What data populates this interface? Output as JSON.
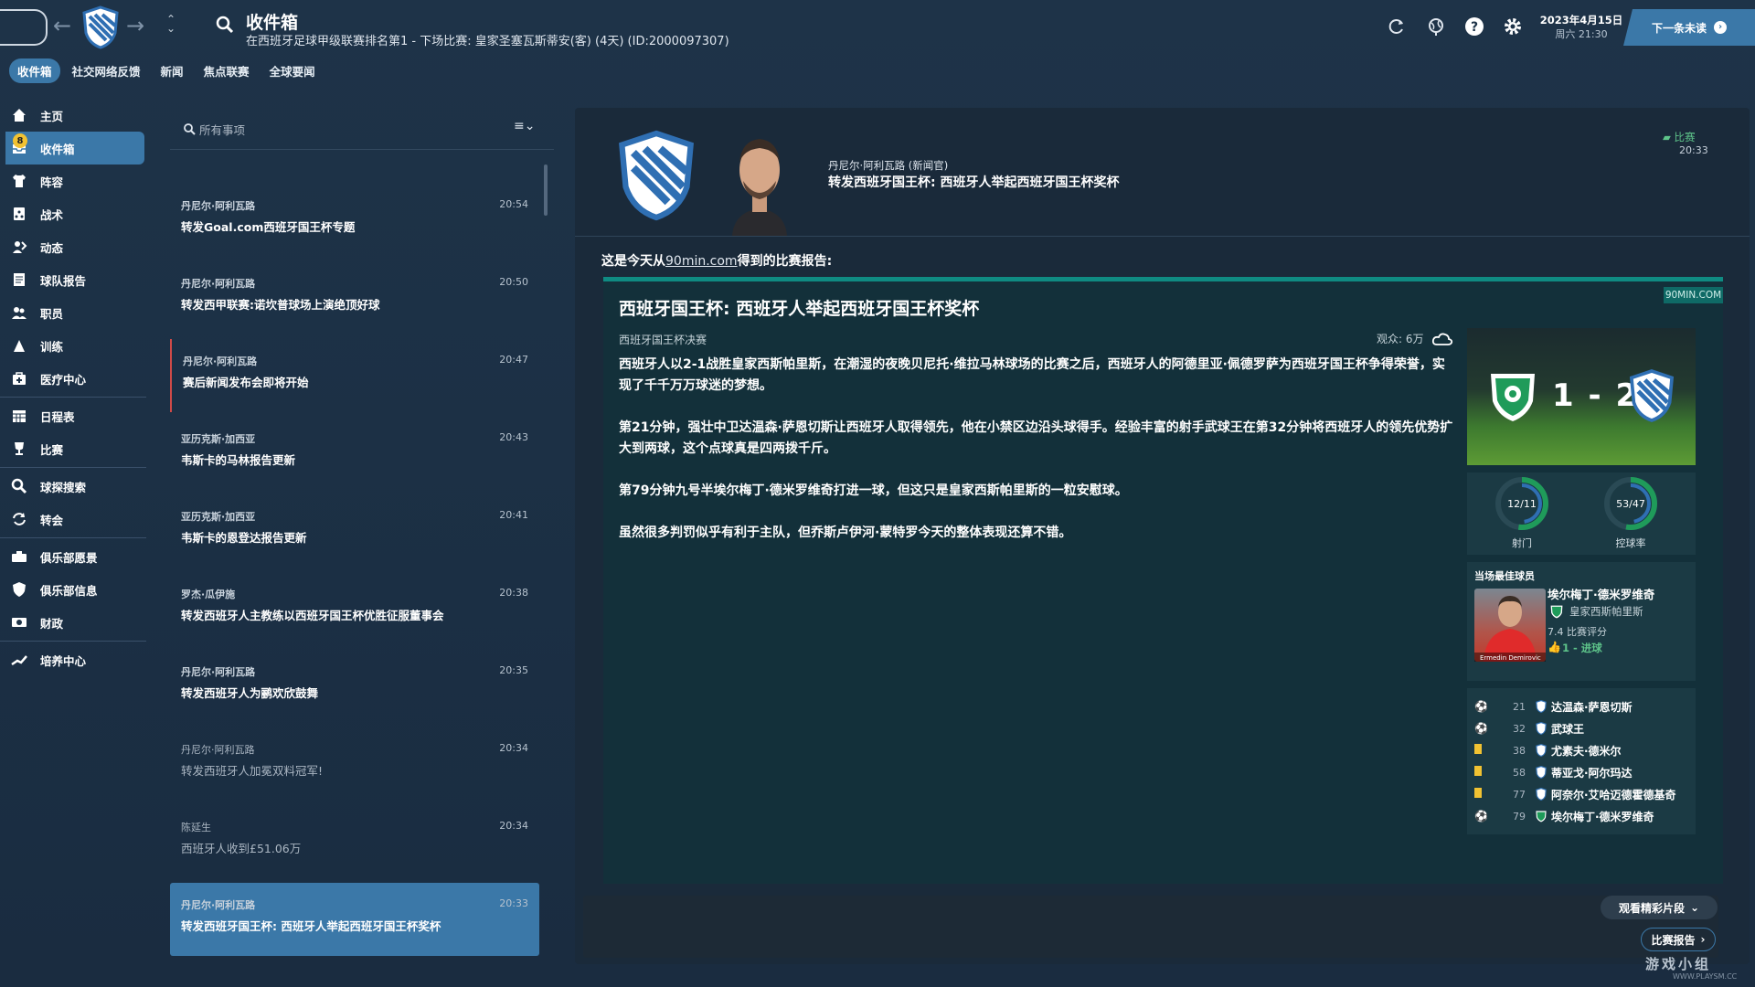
{
  "header": {
    "title": "收件箱",
    "subtitle": "在西班牙足球甲级联赛排名第1 - 下场比赛: 皇家圣塞瓦斯蒂安(客) (4天) (ID:2000097307)",
    "date": "2023年4月15日",
    "day_time": "周六 21:30",
    "next_button": "下一条未读"
  },
  "tabs": [
    {
      "label": "收件箱",
      "active": true
    },
    {
      "label": "社交网络反馈"
    },
    {
      "label": "新闻"
    },
    {
      "label": "焦点联赛"
    },
    {
      "label": "全球要闻"
    }
  ],
  "sidebar": {
    "badge": "8",
    "items": [
      {
        "label": "主页",
        "icon": "home-icon"
      },
      {
        "label": "收件箱",
        "icon": "inbox-icon"
      },
      {
        "label": "阵容",
        "icon": "shirt-icon"
      },
      {
        "label": "战术",
        "icon": "tactics-icon"
      },
      {
        "label": "动态",
        "icon": "dynamics-icon"
      },
      {
        "label": "球队报告",
        "icon": "report-icon"
      },
      {
        "label": "职员",
        "icon": "staff-icon"
      },
      {
        "label": "训练",
        "icon": "training-icon"
      },
      {
        "label": "医疗中心",
        "icon": "medical-icon"
      },
      {
        "label": "日程表",
        "icon": "calendar-icon"
      },
      {
        "label": "比赛",
        "icon": "trophy-icon"
      },
      {
        "label": "球探搜索",
        "icon": "scout-icon"
      },
      {
        "label": "转会",
        "icon": "transfer-icon"
      },
      {
        "label": "俱乐部愿景",
        "icon": "vision-icon"
      },
      {
        "label": "俱乐部信息",
        "icon": "club-info-icon"
      },
      {
        "label": "财政",
        "icon": "finance-icon"
      },
      {
        "label": "培养中心",
        "icon": "development-icon"
      }
    ]
  },
  "message_list": {
    "search_placeholder": "所有事项",
    "messages": [
      {
        "sender": "丹尼尔·阿利瓦路",
        "subject": "转发Goal.com西班牙国王杯专题",
        "time": "20:54"
      },
      {
        "sender": "丹尼尔·阿利瓦路",
        "subject": "转发西甲联赛:诺坎普球场上演绝顶好球",
        "time": "20:50"
      },
      {
        "sender": "丹尼尔·阿利瓦路",
        "subject": "赛后新闻发布会即将开始",
        "time": "20:47"
      },
      {
        "sender": "亚历克斯·加西亚",
        "subject": "韦斯卡的马林报告更新",
        "time": "20:43"
      },
      {
        "sender": "亚历克斯·加西亚",
        "subject": "韦斯卡的恩登达报告更新",
        "time": "20:41"
      },
      {
        "sender": "罗杰·瓜伊施",
        "subject": "转发西班牙人主教练以西班牙国王杯优胜征服董事会",
        "time": "20:38"
      },
      {
        "sender": "丹尼尔·阿利瓦路",
        "subject": "转发西班牙人为鹂欢欣鼓舞",
        "time": "20:35"
      },
      {
        "sender": "丹尼尔·阿利瓦路",
        "subject": "转发西班牙人加冕双料冠军!",
        "time": "20:34"
      },
      {
        "sender": "陈延生",
        "subject": "西班牙人收到£51.06万",
        "time": "20:34"
      },
      {
        "sender": "丹尼尔·阿利瓦路",
        "subject": "转发西班牙国王杯: 西班牙人举起西班牙国王杯奖杯",
        "time": "20:33"
      }
    ]
  },
  "detail": {
    "from": "丹尼尔·阿利瓦路 (新闻官)",
    "subject": "转发西班牙国王杯: 西班牙人举起西班牙国王杯奖杯",
    "tag": "比赛",
    "time": "20:33",
    "intro_prefix": "这是今天从",
    "intro_link": "90min.com",
    "intro_suffix": "得到的比赛报告:",
    "article": {
      "source": "90MIN.COM",
      "title": "西班牙国王杯: 西班牙人举起西班牙国王杯奖杯",
      "competition": "西班牙国王杯决赛",
      "attendance": "观众: 6万",
      "paragraphs": [
        "西班牙人以2-1战胜皇家西斯帕里斯，在潮湿的夜晚贝尼托·维拉马林球场的比赛之后，西班牙人的阿德里亚·佩德罗萨为西班牙国王杯争得荣誉，实现了千千万万球迷的梦想。",
        "第21分钟，强壮中卫达温森·萨恩切斯让西班牙人取得领先，他在小禁区边沿头球得手。经验丰富的射手武球王在第32分钟将西班牙人的领先优势扩大到两球，这个点球真是四两拨千斤。",
        "第79分钟九号半埃尔梅丁·德米罗维奇打进一球，但这只是皇家西斯帕里斯的一粒安慰球。",
        "虽然很多判罚似乎有利于主队，但乔斯卢伊河·蒙特罗今天的整体表现还算不错。"
      ]
    },
    "score": "1 - 2",
    "stats": [
      {
        "value": "12/11",
        "label": "射门",
        "home": 12,
        "away": 11
      },
      {
        "value": "53/47",
        "label": "控球率",
        "home": 53,
        "away": 47
      }
    ],
    "motm": {
      "title": "当场最佳球员",
      "name": "埃尔梅丁·德米罗维奇",
      "club": "皇家西斯帕里斯",
      "rating": "7.4  比赛评分",
      "goals": "1 - 进球",
      "photo_caption": "Ermedin Demirovic"
    },
    "events": [
      {
        "minute": "21",
        "type": "goal",
        "team": "away",
        "player": "达温森·萨恩切斯"
      },
      {
        "minute": "32",
        "type": "goal",
        "team": "away",
        "player": "武球王"
      },
      {
        "minute": "38",
        "type": "yellow",
        "team": "away",
        "player": "尤素夫·德米尔"
      },
      {
        "minute": "58",
        "type": "yellow",
        "team": "away",
        "player": "蒂亚戈·阿尔玛达"
      },
      {
        "minute": "77",
        "type": "yellow",
        "team": "away",
        "player": "阿奈尔·艾哈迈德霍德基奇"
      },
      {
        "minute": "79",
        "type": "goal",
        "team": "home",
        "player": "埃尔梅丁·德米罗维奇"
      }
    ],
    "highlights_button": "观看精彩片段",
    "report_button": "比赛报告"
  },
  "watermark": "游戏小组",
  "watermark_url": "WWW.PLAYSM.CC",
  "colors": {
    "accent": "#3b78a8",
    "teal": "#0f8b82",
    "goal_green": "#5ec48a",
    "yellow_card": "#f1c232"
  }
}
